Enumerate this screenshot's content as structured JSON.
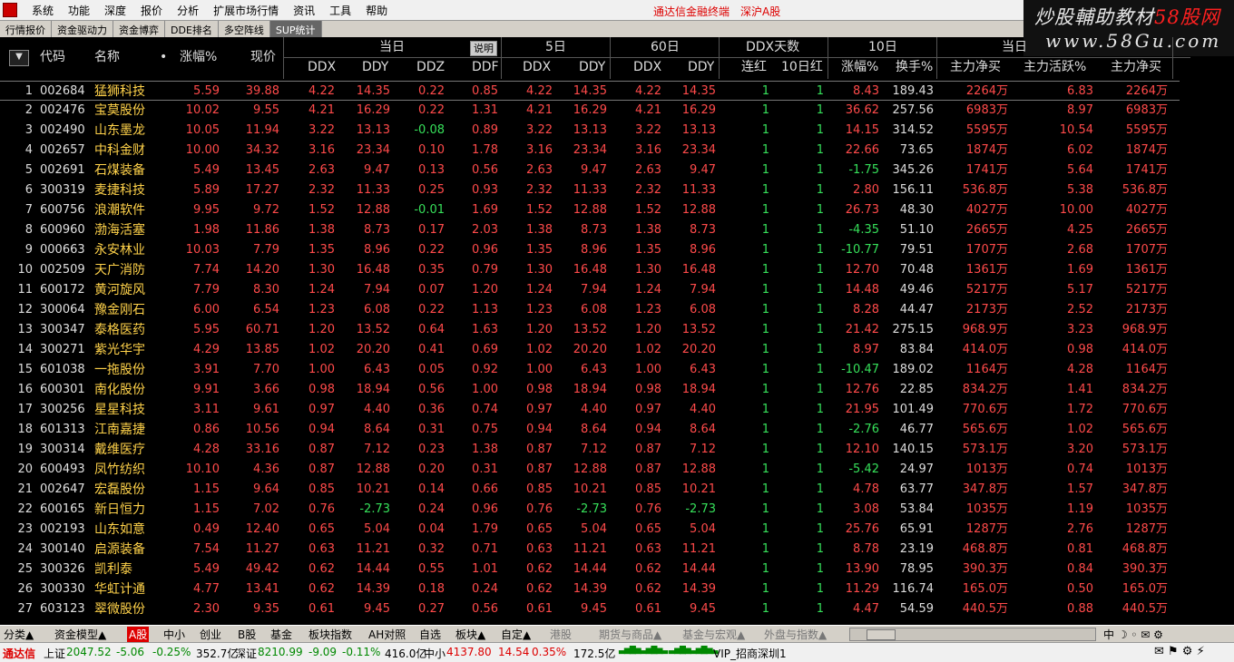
{
  "menubar": {
    "items": [
      "系统",
      "功能",
      "深度",
      "报价",
      "分析",
      "扩展市场行情",
      "资讯",
      "工具",
      "帮助"
    ],
    "app_title": "通达信金融终端",
    "market": "深沪A股"
  },
  "watermark": {
    "line1_a": "炒股輔助教材",
    "line1_b": "58股网",
    "line2": "www.58Gu.com"
  },
  "tabs": [
    {
      "label": "行情报价"
    },
    {
      "label": "资金驱动力"
    },
    {
      "label": "资金博弈"
    },
    {
      "label": "DDE排名"
    },
    {
      "label": "多空阵线"
    },
    {
      "label": "SUP统计"
    }
  ],
  "header": {
    "top": {
      "today": "当日",
      "explain": "说明",
      "d5": "5日",
      "d60": "60日",
      "ddx_days": "DDX天数",
      "d10": "10日",
      "today2": "当日"
    },
    "cols": {
      "code": "代码",
      "name": "名称",
      "chg": "涨幅%",
      "price": "现价",
      "ddx": "DDX",
      "ddy": "DDY",
      "ddz": "DDZ",
      "ddf": "DDF",
      "ddx5": "DDX",
      "ddy5": "DDY",
      "ddx60": "DDX",
      "ddy60": "DDY",
      "lianhong": "连红",
      "hong10": "10日红",
      "chg10": "涨幅%",
      "turnover": "换手%",
      "net": "主力净买",
      "active": "主力活跃%",
      "net2": "主力净买"
    }
  },
  "rows": [
    [
      "1",
      "002684",
      "猛狮科技",
      "5.59",
      "39.88",
      "4.22",
      "14.35",
      "0.22",
      "0.85",
      "4.22",
      "14.35",
      "4.22",
      "14.35",
      "1",
      "1",
      "8.43",
      "189.43",
      "2264万",
      "6.83",
      "2264万"
    ],
    [
      "2",
      "002476",
      "宝莫股份",
      "10.02",
      "9.55",
      "4.21",
      "16.29",
      "0.22",
      "1.31",
      "4.21",
      "16.29",
      "4.21",
      "16.29",
      "1",
      "1",
      "36.62",
      "257.56",
      "6983万",
      "8.97",
      "6983万"
    ],
    [
      "3",
      "002490",
      "山东墨龙",
      "10.05",
      "11.94",
      "3.22",
      "13.13",
      "-0.08",
      "0.89",
      "3.22",
      "13.13",
      "3.22",
      "13.13",
      "1",
      "1",
      "14.15",
      "314.52",
      "5595万",
      "10.54",
      "5595万"
    ],
    [
      "4",
      "002657",
      "中科金财",
      "10.00",
      "34.32",
      "3.16",
      "23.34",
      "0.10",
      "1.78",
      "3.16",
      "23.34",
      "3.16",
      "23.34",
      "1",
      "1",
      "22.66",
      "73.65",
      "1874万",
      "6.02",
      "1874万"
    ],
    [
      "5",
      "002691",
      "石煤装备",
      "5.49",
      "13.45",
      "2.63",
      "9.47",
      "0.13",
      "0.56",
      "2.63",
      "9.47",
      "2.63",
      "9.47",
      "1",
      "1",
      "-1.75",
      "345.26",
      "1741万",
      "5.64",
      "1741万"
    ],
    [
      "6",
      "300319",
      "麦捷科技",
      "5.89",
      "17.27",
      "2.32",
      "11.33",
      "0.25",
      "0.93",
      "2.32",
      "11.33",
      "2.32",
      "11.33",
      "1",
      "1",
      "2.80",
      "156.11",
      "536.8万",
      "5.38",
      "536.8万"
    ],
    [
      "7",
      "600756",
      "浪潮软件",
      "9.95",
      "9.72",
      "1.52",
      "12.88",
      "-0.01",
      "1.69",
      "1.52",
      "12.88",
      "1.52",
      "12.88",
      "1",
      "1",
      "26.73",
      "48.30",
      "4027万",
      "10.00",
      "4027万"
    ],
    [
      "8",
      "600960",
      "渤海活塞",
      "1.98",
      "11.86",
      "1.38",
      "8.73",
      "0.17",
      "2.03",
      "1.38",
      "8.73",
      "1.38",
      "8.73",
      "1",
      "1",
      "-4.35",
      "51.10",
      "2665万",
      "4.25",
      "2665万"
    ],
    [
      "9",
      "000663",
      "永安林业",
      "10.03",
      "7.79",
      "1.35",
      "8.96",
      "0.22",
      "0.96",
      "1.35",
      "8.96",
      "1.35",
      "8.96",
      "1",
      "1",
      "-10.77",
      "79.51",
      "1707万",
      "2.68",
      "1707万"
    ],
    [
      "10",
      "002509",
      "天广消防",
      "7.74",
      "14.20",
      "1.30",
      "16.48",
      "0.35",
      "0.79",
      "1.30",
      "16.48",
      "1.30",
      "16.48",
      "1",
      "1",
      "12.70",
      "70.48",
      "1361万",
      "1.69",
      "1361万"
    ],
    [
      "11",
      "600172",
      "黄河旋风",
      "7.79",
      "8.30",
      "1.24",
      "7.94",
      "0.07",
      "1.20",
      "1.24",
      "7.94",
      "1.24",
      "7.94",
      "1",
      "1",
      "14.48",
      "49.46",
      "5217万",
      "5.17",
      "5217万"
    ],
    [
      "12",
      "300064",
      "豫金刚石",
      "6.00",
      "6.54",
      "1.23",
      "6.08",
      "0.22",
      "1.13",
      "1.23",
      "6.08",
      "1.23",
      "6.08",
      "1",
      "1",
      "8.28",
      "44.47",
      "2173万",
      "2.52",
      "2173万"
    ],
    [
      "13",
      "300347",
      "泰格医药",
      "5.95",
      "60.71",
      "1.20",
      "13.52",
      "0.64",
      "1.63",
      "1.20",
      "13.52",
      "1.20",
      "13.52",
      "1",
      "1",
      "21.42",
      "275.15",
      "968.9万",
      "3.23",
      "968.9万"
    ],
    [
      "14",
      "300271",
      "紫光华宇",
      "4.29",
      "13.85",
      "1.02",
      "20.20",
      "0.41",
      "0.69",
      "1.02",
      "20.20",
      "1.02",
      "20.20",
      "1",
      "1",
      "8.97",
      "83.84",
      "414.0万",
      "0.98",
      "414.0万"
    ],
    [
      "15",
      "601038",
      "一拖股份",
      "3.91",
      "7.70",
      "1.00",
      "6.43",
      "0.05",
      "0.92",
      "1.00",
      "6.43",
      "1.00",
      "6.43",
      "1",
      "1",
      "-10.47",
      "189.02",
      "1164万",
      "4.28",
      "1164万"
    ],
    [
      "16",
      "600301",
      "南化股份",
      "9.91",
      "3.66",
      "0.98",
      "18.94",
      "0.56",
      "1.00",
      "0.98",
      "18.94",
      "0.98",
      "18.94",
      "1",
      "1",
      "12.76",
      "22.85",
      "834.2万",
      "1.41",
      "834.2万"
    ],
    [
      "17",
      "300256",
      "星星科技",
      "3.11",
      "9.61",
      "0.97",
      "4.40",
      "0.36",
      "0.74",
      "0.97",
      "4.40",
      "0.97",
      "4.40",
      "1",
      "1",
      "21.95",
      "101.49",
      "770.6万",
      "1.72",
      "770.6万"
    ],
    [
      "18",
      "601313",
      "江南嘉捷",
      "0.86",
      "10.56",
      "0.94",
      "8.64",
      "0.31",
      "0.75",
      "0.94",
      "8.64",
      "0.94",
      "8.64",
      "1",
      "1",
      "-2.76",
      "46.77",
      "565.6万",
      "1.02",
      "565.6万"
    ],
    [
      "19",
      "300314",
      "戴维医疗",
      "4.28",
      "33.16",
      "0.87",
      "7.12",
      "0.23",
      "1.38",
      "0.87",
      "7.12",
      "0.87",
      "7.12",
      "1",
      "1",
      "12.10",
      "140.15",
      "573.1万",
      "3.20",
      "573.1万"
    ],
    [
      "20",
      "600493",
      "凤竹纺织",
      "10.10",
      "4.36",
      "0.87",
      "12.88",
      "0.20",
      "0.31",
      "0.87",
      "12.88",
      "0.87",
      "12.88",
      "1",
      "1",
      "-5.42",
      "24.97",
      "1013万",
      "0.74",
      "1013万"
    ],
    [
      "21",
      "002647",
      "宏磊股份",
      "1.15",
      "9.64",
      "0.85",
      "10.21",
      "0.14",
      "0.66",
      "0.85",
      "10.21",
      "0.85",
      "10.21",
      "1",
      "1",
      "4.78",
      "63.77",
      "347.8万",
      "1.57",
      "347.8万"
    ],
    [
      "22",
      "600165",
      "新日恒力",
      "1.15",
      "7.02",
      "0.76",
      "-2.73",
      "0.24",
      "0.96",
      "0.76",
      "-2.73",
      "0.76",
      "-2.73",
      "1",
      "1",
      "3.08",
      "53.84",
      "1035万",
      "1.19",
      "1035万"
    ],
    [
      "23",
      "002193",
      "山东如意",
      "0.49",
      "12.40",
      "0.65",
      "5.04",
      "0.04",
      "1.79",
      "0.65",
      "5.04",
      "0.65",
      "5.04",
      "1",
      "1",
      "25.76",
      "65.91",
      "1287万",
      "2.76",
      "1287万"
    ],
    [
      "24",
      "300140",
      "启源装备",
      "7.54",
      "11.27",
      "0.63",
      "11.21",
      "0.32",
      "0.71",
      "0.63",
      "11.21",
      "0.63",
      "11.21",
      "1",
      "1",
      "8.78",
      "23.19",
      "468.8万",
      "0.81",
      "468.8万"
    ],
    [
      "25",
      "300326",
      "凯利泰",
      "5.49",
      "49.42",
      "0.62",
      "14.44",
      "0.55",
      "1.01",
      "0.62",
      "14.44",
      "0.62",
      "14.44",
      "1",
      "1",
      "13.90",
      "78.95",
      "390.3万",
      "0.84",
      "390.3万"
    ],
    [
      "26",
      "300330",
      "华虹计通",
      "4.77",
      "13.41",
      "0.62",
      "14.39",
      "0.18",
      "0.24",
      "0.62",
      "14.39",
      "0.62",
      "14.39",
      "1",
      "1",
      "11.29",
      "116.74",
      "165.0万",
      "0.50",
      "165.0万"
    ],
    [
      "27",
      "603123",
      "翠微股份",
      "2.30",
      "9.35",
      "0.61",
      "9.45",
      "0.27",
      "0.56",
      "0.61",
      "9.45",
      "0.61",
      "9.45",
      "1",
      "1",
      "4.47",
      "54.59",
      "440.5万",
      "0.88",
      "440.5万"
    ]
  ],
  "bottom_tabs": [
    "分类▲",
    "资金模型▲",
    "A股",
    "中小",
    "创业",
    "B股",
    "基金",
    "板块指数",
    "AH对照",
    "自选",
    "板块▲",
    "自定▲",
    "港股",
    "期货与商品▲",
    "基金与宏观▲",
    "外盘与指数▲"
  ],
  "bottom_icons": "中 ☽ ◦ ✉ ⚙",
  "status": {
    "brand": "通达信",
    "sh_label": "上证",
    "sh_value": "2047.52",
    "sh_chg": "-5.06",
    "sh_pct": "-0.25%",
    "sh_amt": "352.7亿",
    "sz_label": "深证",
    "sz_value": "8210.99",
    "sz_chg": "-9.09",
    "sz_pct": "-0.11%",
    "sz_amt": "416.0亿",
    "zx_label": "中小",
    "zx_value": "4137.80",
    "zx_chg": "14.54",
    "zx_pct": "0.35%",
    "zx_amt": "172.5亿",
    "broker": "VIP_招商深圳1"
  },
  "colors": {
    "up": "#ff4a4a",
    "down": "#36e05a",
    "name": "#ffd24a"
  }
}
